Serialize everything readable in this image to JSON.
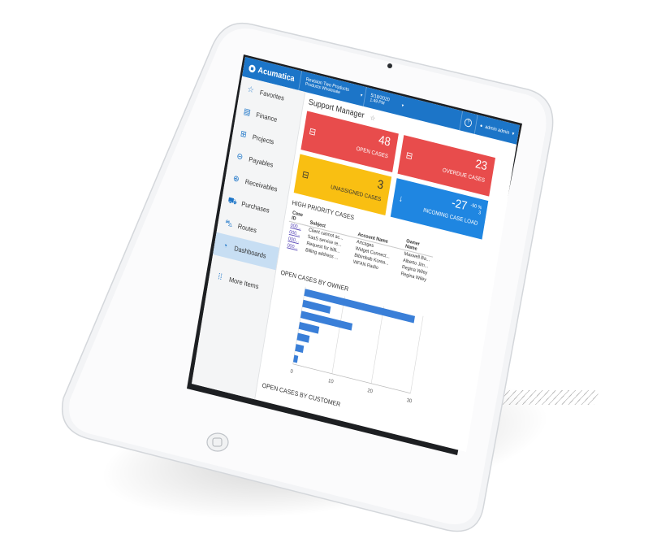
{
  "topbar": {
    "brand": "Acumatica",
    "company_line1": "Revision Two Products",
    "company_line2": "Products Wholesale",
    "date": "5/18/2020",
    "time": "1:49 PM",
    "help_icon": "help-icon",
    "user": "admin admin"
  },
  "sidebar": {
    "items": [
      {
        "label": "Favorites",
        "icon": "star-icon"
      },
      {
        "label": "Finance",
        "icon": "calculator-icon"
      },
      {
        "label": "Projects",
        "icon": "projects-icon"
      },
      {
        "label": "Payables",
        "icon": "minus-circle-icon"
      },
      {
        "label": "Receivables",
        "icon": "plus-circle-icon"
      },
      {
        "label": "Purchases",
        "icon": "cart-icon"
      },
      {
        "label": "Routes",
        "icon": "truck-icon"
      },
      {
        "label": "Dashboards",
        "icon": "gauge-icon",
        "active": true
      }
    ],
    "more": "More Items"
  },
  "page": {
    "title": "Support Manager"
  },
  "tiles": {
    "open_cases": {
      "value": "48",
      "label": "OPEN CASES",
      "color": "#e84c4c"
    },
    "overdue_cases": {
      "value": "23",
      "label": "OVERDUE CASES",
      "color": "#e84c4c"
    },
    "unassigned_cases": {
      "value": "3",
      "label": "UNASSIGNED CASES",
      "color": "#f9bf12"
    },
    "incoming_load": {
      "value": "-27",
      "pct": "-90 %",
      "sub": "3",
      "label": "INCOMING CASE LOAD",
      "color": "#1f86e1"
    }
  },
  "high_priority": {
    "title": "HIGH PRIORITY CASES",
    "columns": [
      "Case ID",
      "Subject",
      "Account Name",
      "Owner Name"
    ],
    "rows": [
      [
        "000...",
        "Client cannot ac...",
        "Artcages",
        "Maxwell Ba..."
      ],
      [
        "000...",
        "SaaS service re...",
        "Widget Connect...",
        "Alberto Jim..."
      ],
      [
        "000...",
        "Request for billi...",
        "Bibimbab Korea...",
        "Regina Wiley"
      ],
      [
        "000...",
        "Billing address ...",
        "WFAN Radio",
        "Regina Wiley"
      ]
    ]
  },
  "open_by_owner": {
    "title": "OPEN CASES BY OWNER"
  },
  "open_by_customer": {
    "title": "OPEN CASES BY CUSTOMER"
  },
  "chart_data": {
    "type": "bar",
    "orientation": "horizontal",
    "title": "OPEN CASES BY OWNER",
    "categories": [
      "",
      "",
      "",
      "",
      "",
      "",
      ""
    ],
    "values": [
      28,
      7,
      13,
      5,
      3,
      2,
      1
    ],
    "xlim": [
      0,
      30
    ],
    "xticks": [
      "0",
      "10",
      "20",
      "30"
    ],
    "color": "#3a7fd8",
    "grid": true
  },
  "colors": {
    "accent": "#1c75c8",
    "active_nav": "#c7def3"
  }
}
